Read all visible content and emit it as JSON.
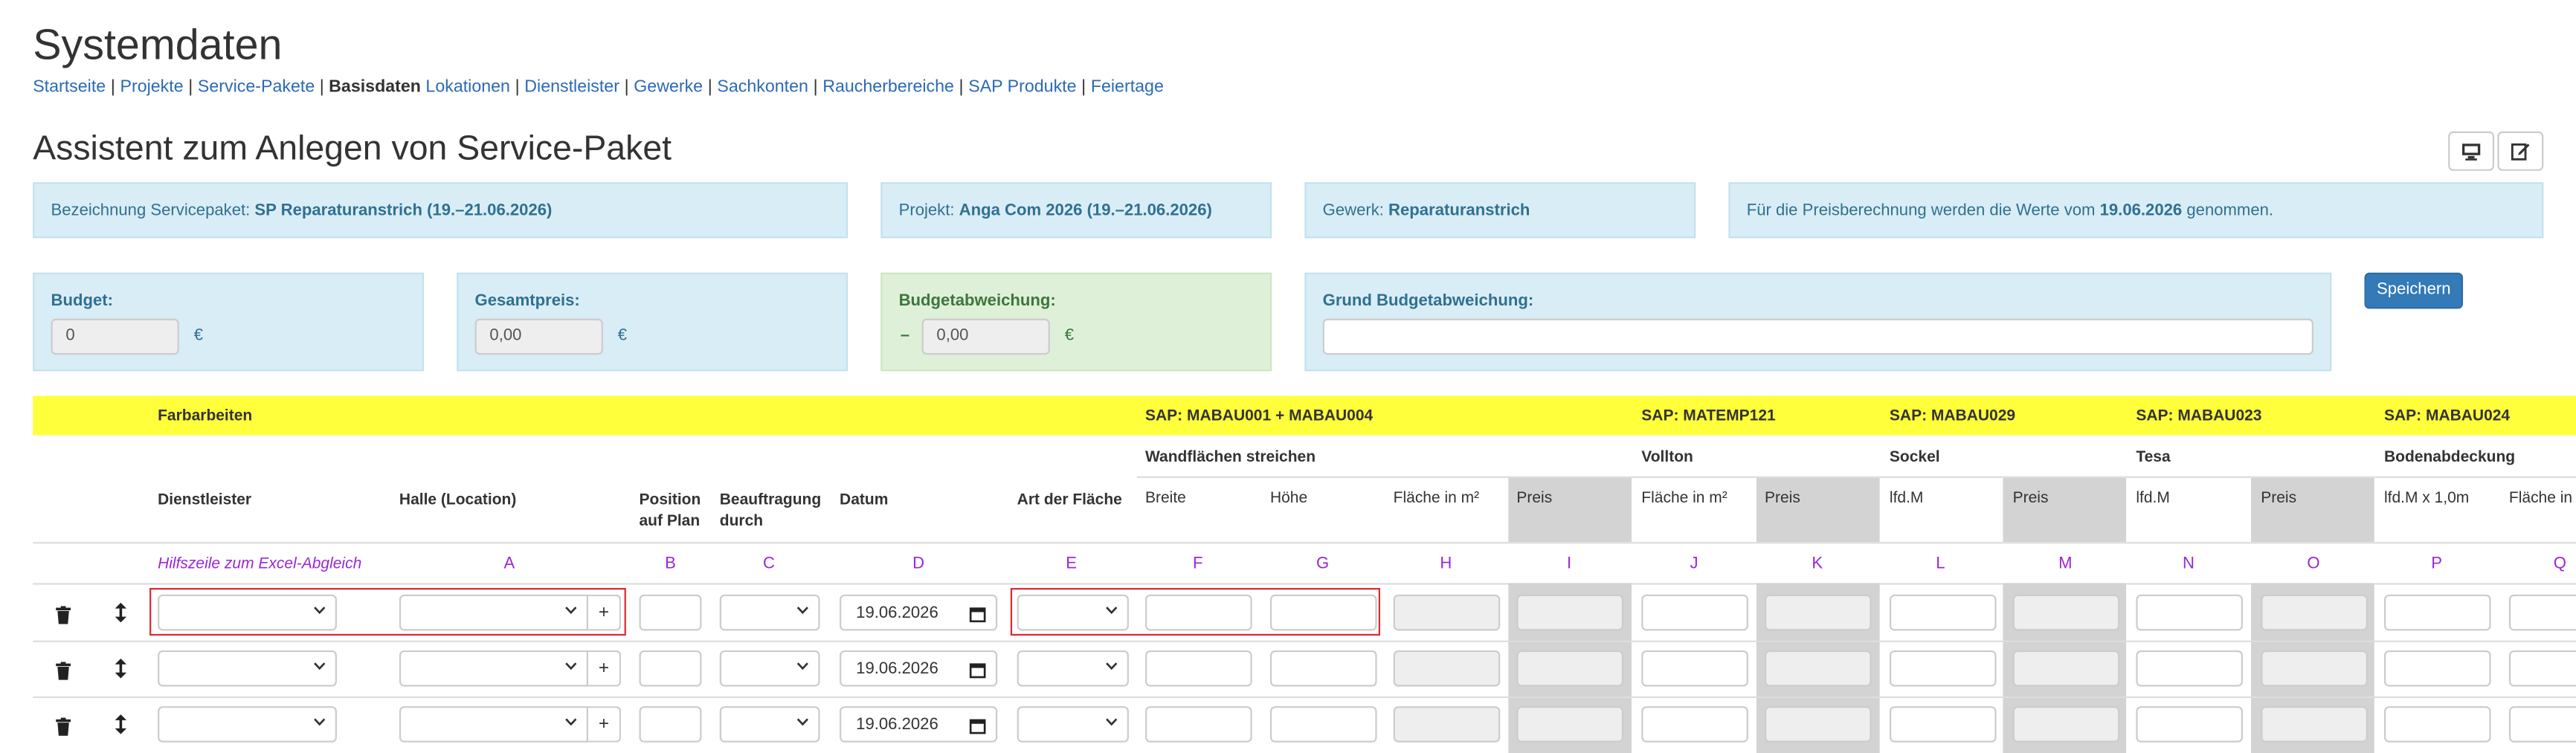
{
  "page_title": "Systemdaten",
  "breadcrumb": [
    "Startseite",
    "Projekte",
    "Service-Pakete",
    "Basisdaten",
    "Lokationen",
    "Dienstleister",
    "Gewerke",
    "Sachkonten",
    "Raucherbereiche",
    "SAP Produkte",
    "Feiertage"
  ],
  "breadcrumb_active": "Basisdaten",
  "subtitle": "Assistent zum Anlegen von Service-Paket",
  "icons": {
    "desktop": "desktop-icon",
    "edit": "edit-icon",
    "delete": "trash-icon",
    "move": "move-vertical-icon",
    "calendar": "calendar-icon",
    "chevron": "chevron-down-icon"
  },
  "info": {
    "bezeichnung_label": "Bezeichnung Servicepaket:",
    "bezeichnung_value": "SP Reparaturanstrich (19.–21.06.2026)",
    "projekt_label": "Projekt:",
    "projekt_value": "Anga Com 2026 (19.–21.06.2026)",
    "gewerk_label": "Gewerk:",
    "gewerk_value": "Reparaturanstrich",
    "preis_prefix": "Für die Preisberechnung werden die Werte vom",
    "preis_date": "19.06.2026",
    "preis_suffix": "genommen."
  },
  "budget": {
    "label": "Budget:",
    "value": "0",
    "currency": "€"
  },
  "gesamtpreis": {
    "label": "Gesamtpreis:",
    "value": "0,00",
    "currency": "€"
  },
  "abweichung": {
    "label": "Budgetabweichung:",
    "sign": "–",
    "value": "0,00",
    "currency": "€"
  },
  "grund": {
    "label": "Grund Budgetabweichung:",
    "value": ""
  },
  "save_label": "Speichern",
  "colors": {
    "accent": "#337ab7",
    "yellow": "#ffff3c",
    "info_bg": "#d9edf7",
    "success_bg": "#dff0d8",
    "letter": "#9a27d6",
    "highlight": "#e0282f"
  },
  "table": {
    "group_label": "Farbarbeiten",
    "sap": [
      "SAP: MABAU001 + MABAU004",
      "SAP: MATEMP121",
      "SAP: MABAU029",
      "SAP: MABAU023",
      "SAP: MABAU024"
    ],
    "subgroups": [
      "Wandflächen streichen",
      "Vollton",
      "Sockel",
      "Tesa",
      "Bodenabdeckung"
    ],
    "columns": {
      "dienstleister": "Dienstleister",
      "halle": "Halle (Location)",
      "position": "Position auf Plan",
      "beauftragung": "Beauftragung durch",
      "datum": "Datum",
      "art": "Art der Fläche",
      "breite": "Breite",
      "hoehe": "Höhe",
      "flaeche": "Fläche in m²",
      "preis": "Preis",
      "vollton_flaeche": "Fläche in m²",
      "ifdm_sockel": "lfd.M",
      "ifdm_tesa": "lfd.M",
      "ifdm_boden": "lfd.M x 1,0m",
      "flaeche_boden": "Fläche in"
    },
    "helper_label": "Hilfszeile zum Excel-Abgleich",
    "letters": [
      "A",
      "B",
      "C",
      "D",
      "E",
      "F",
      "G",
      "H",
      "I",
      "J",
      "K",
      "L",
      "M",
      "N",
      "O",
      "P",
      "Q"
    ],
    "add_label": "+",
    "rows": [
      {
        "datum": "19.06.2026"
      },
      {
        "datum": "19.06.2026"
      },
      {
        "datum": "19.06.2026"
      }
    ]
  }
}
